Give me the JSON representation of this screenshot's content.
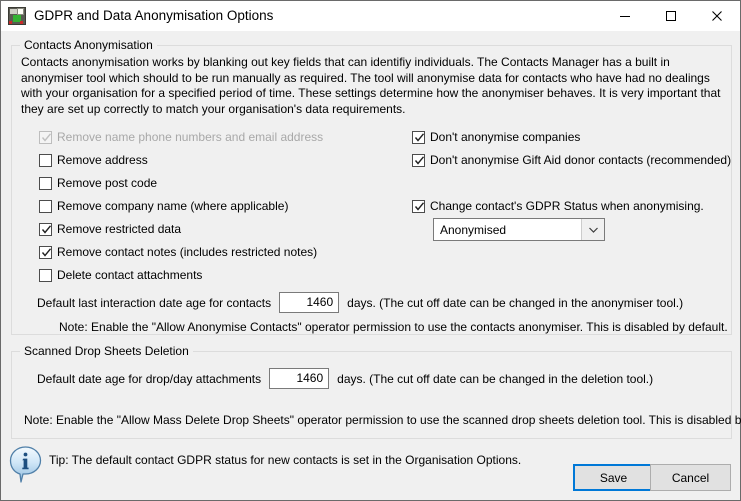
{
  "window": {
    "title": "GDPR and Data Anonymisation Options",
    "icon": "contacts-anonymise-icon",
    "controls": {
      "minimize": "minimize-icon",
      "maximize": "maximize-icon",
      "close": "close-icon"
    }
  },
  "contacts_group": {
    "title": "Contacts Anonymisation",
    "description": "Contacts anonymisation works by blanking out key fields that can identifiy individuals.  The Contacts Manager has a built in anonymiser tool which should to be run manually as required.  The tool will anonymise data for contacts who have had no dealings with your organisation for a specified period of time.  These settings determine how the anonymiser behaves.  It is very important that they are set up correctly to match your organisation's data requirements.",
    "left_checkboxes": [
      {
        "label": "Remove name phone numbers and email address",
        "checked": true,
        "disabled": true
      },
      {
        "label": "Remove address",
        "checked": false,
        "disabled": false
      },
      {
        "label": "Remove  post code",
        "checked": false,
        "disabled": false
      },
      {
        "label": "Remove company name (where applicable)",
        "checked": false,
        "disabled": false
      },
      {
        "label": "Remove restricted data",
        "checked": true,
        "disabled": false
      },
      {
        "label": "Remove contact notes (includes restricted notes)",
        "checked": true,
        "disabled": false
      },
      {
        "label": "Delete contact attachments",
        "checked": false,
        "disabled": false
      }
    ],
    "right_checkboxes": [
      {
        "label": "Don't anonymise companies",
        "checked": true,
        "disabled": false
      },
      {
        "label": "Don't anonymise Gift Aid donor contacts (recommended)",
        "checked": true,
        "disabled": false
      },
      {
        "label": "Change contact's GDPR Status when anonymising.",
        "checked": true,
        "disabled": false
      }
    ],
    "gdpr_status_select": {
      "value": "Anonymised",
      "arrow_icon": "chevron-down-icon"
    },
    "date_age_row": {
      "label": "Default last interaction date age for contacts",
      "value": "1460",
      "suffix": "days.  (The cut off date can be changed in the anonymiser tool.)"
    },
    "note": "Note: Enable the \"Allow Anonymise Contacts\" operator permission to use the contacts anonymiser.  This is disabled by default."
  },
  "drop_sheets_group": {
    "title": "Scanned Drop Sheets Deletion",
    "date_age_row": {
      "label": "Default date age for drop/day attachments",
      "value": "1460",
      "suffix": "days.  (The cut off date can be changed in the deletion tool.)"
    }
  },
  "bottom_note": "Note: Enable the \"Allow Mass Delete Drop Sheets\" operator permission to use the scanned drop sheets deletion tool.  This is disabled by default.",
  "footer": {
    "info_icon": "info-icon",
    "tip": "Tip: The default contact GDPR status for new contacts is set in the Organisation Options.",
    "save_label": "Save",
    "cancel_label": "Cancel"
  },
  "colors": {
    "accent": "#0078d7",
    "dialog_bg": "#f0f0f0",
    "group_border": "#dcdcdc",
    "disabled_text": "#a8a8a8"
  }
}
